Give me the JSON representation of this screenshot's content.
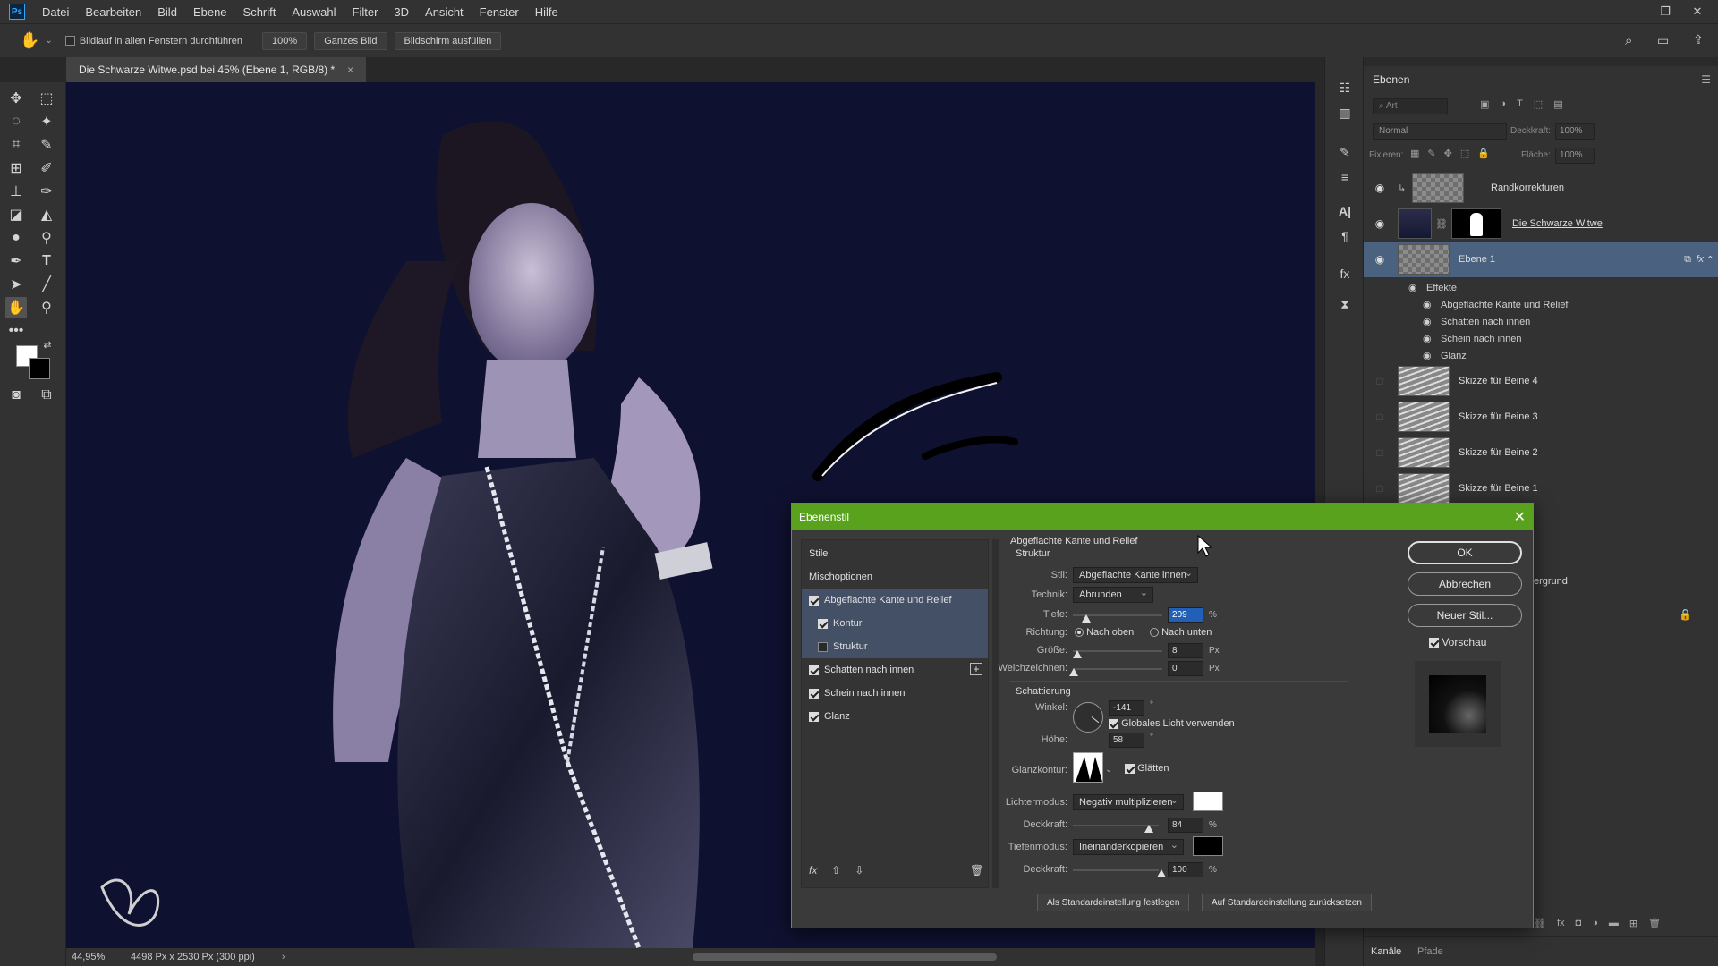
{
  "app": {
    "logo": "Ps"
  },
  "menu": [
    "Datei",
    "Bearbeiten",
    "Bild",
    "Ebene",
    "Schrift",
    "Auswahl",
    "Filter",
    "3D",
    "Ansicht",
    "Fenster",
    "Hilfe"
  ],
  "window_controls": {
    "minimize": "—",
    "restore": "❐",
    "close": "✕"
  },
  "options": {
    "scroll_all_label": "Bildlauf in allen Fenstern durchführen",
    "zoom_value": "100%",
    "fit_button": "Ganzes Bild",
    "fill_button": "Bildschirm ausfüllen"
  },
  "document_tab": {
    "title": "Die Schwarze Witwe.psd bei 45% (Ebene 1, RGB/8) *",
    "close": "×"
  },
  "status": {
    "zoom": "44,95%",
    "size": "4498 Px x 2530 Px (300 ppi)"
  },
  "layers_panel": {
    "tab": "Ebenen",
    "search_placeholder": "Art",
    "blend_mode": "Normal",
    "opacity_label": "Deckkraft:",
    "opacity_value": "100%",
    "lock_label": "Fixieren:",
    "fill_label": "Fläche:",
    "fill_value": "100%",
    "layers": [
      {
        "name": "Randkorrekturen",
        "visible": true
      },
      {
        "name": "Die Schwarze Witwe",
        "visible": true
      },
      {
        "name": "Ebene 1",
        "visible": true,
        "selected": true
      },
      {
        "name": "Skizze für Beine 4",
        "visible": false
      },
      {
        "name": "Skizze für Beine 3",
        "visible": false
      },
      {
        "name": "Skizze für Beine 2",
        "visible": false
      },
      {
        "name": "Skizze für Beine 1",
        "visible": false
      }
    ],
    "effects_label": "Effekte",
    "effects": [
      "Abgeflachte Kante und Relief",
      "Schatten nach innen",
      "Schein nach innen",
      "Glanz"
    ],
    "background_partial": "ergrund",
    "bottom_tabs": [
      "Kanäle",
      "Pfade"
    ]
  },
  "dialog": {
    "title": "Ebenenstil",
    "styles_header": "Stile",
    "blend_options": "Mischoptionen",
    "style_items": [
      {
        "label": "Abgeflachte Kante und Relief",
        "checked": true,
        "highlight": true,
        "indent": false
      },
      {
        "label": "Kontur",
        "checked": true,
        "highlight": true,
        "indent": true
      },
      {
        "label": "Struktur",
        "checked": false,
        "highlight": true,
        "indent": true
      },
      {
        "label": "Schatten nach innen",
        "checked": true,
        "highlight": false,
        "indent": false
      },
      {
        "label": "Schein nach innen",
        "checked": true,
        "highlight": false,
        "indent": false
      },
      {
        "label": "Glanz",
        "checked": true,
        "highlight": false,
        "indent": false
      }
    ],
    "section_title": "Abgeflachte Kante und Relief",
    "section_sub": "Struktur",
    "stil_label": "Stil:",
    "stil_value": "Abgeflachte Kante innen",
    "technik_label": "Technik:",
    "technik_value": "Abrunden",
    "tiefe_label": "Tiefe:",
    "tiefe_value": "209",
    "tiefe_unit": "%",
    "richtung_label": "Richtung:",
    "richtung_up": "Nach oben",
    "richtung_down": "Nach unten",
    "groesse_label": "Größe:",
    "groesse_value": "8",
    "groesse_unit": "Px",
    "weich_label": "Weichzeichnen:",
    "weich_value": "0",
    "weich_unit": "Px",
    "schattierung_title": "Schattierung",
    "winkel_label": "Winkel:",
    "winkel_value": "-141",
    "winkel_unit": "°",
    "global_light_label": "Globales Licht verwenden",
    "hoehe_label": "Höhe:",
    "hoehe_value": "58",
    "hoehe_unit": "°",
    "glanzkontur_label": "Glanzkontur:",
    "glaetten_label": "Glätten",
    "lichter_label": "Lichtermodus:",
    "lichter_value": "Negativ multiplizieren",
    "lichter_color": "#ffffff",
    "deck1_label": "Deckkraft:",
    "deck1_value": "84",
    "deck1_unit": "%",
    "tiefen_label": "Tiefenmodus:",
    "tiefen_value": "Ineinanderkopieren",
    "tiefen_color": "#000000",
    "deck2_label": "Deckkraft:",
    "deck2_value": "100",
    "deck2_unit": "%",
    "set_default": "Als Standardeinstellung festlegen",
    "reset_default": "Auf Standardeinstellung zurücksetzen",
    "ok": "OK",
    "cancel": "Abbrechen",
    "new_style": "Neuer Stil...",
    "preview": "Vorschau",
    "fx_label": "fx"
  },
  "colors": {
    "dialog_title": "#58a21d",
    "selected_layer": "#4a6180",
    "canvas_bg": "#0f1130"
  }
}
